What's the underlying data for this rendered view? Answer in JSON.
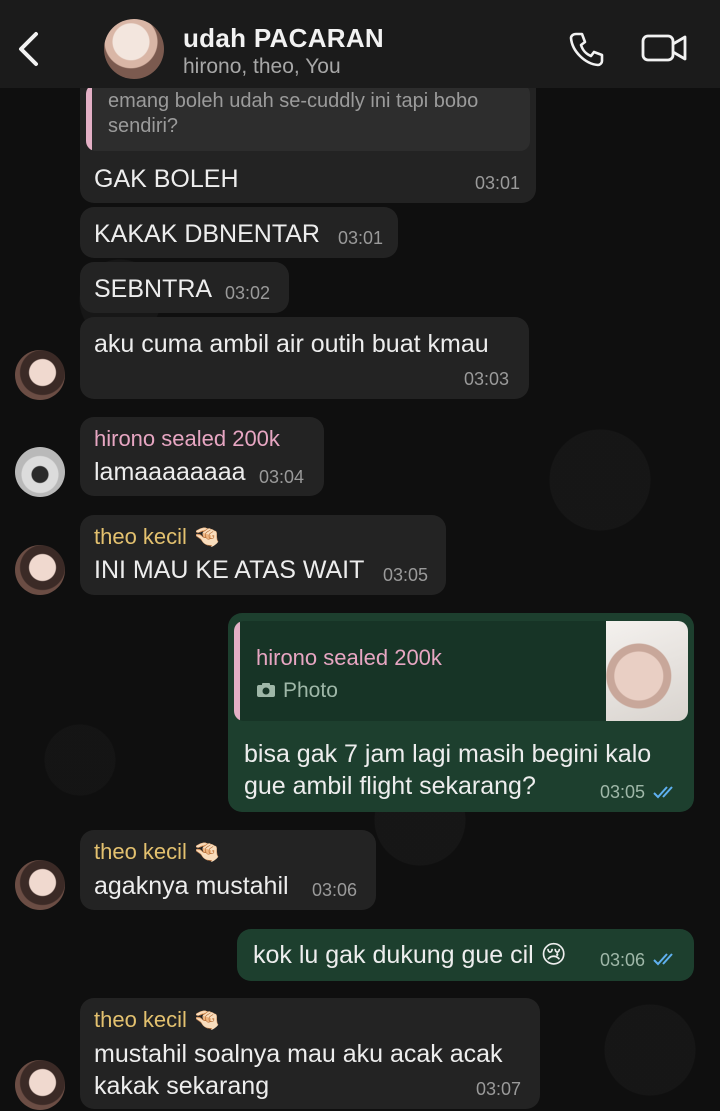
{
  "header": {
    "title": "udah PACARAN",
    "subtitle": "hirono, theo, You"
  },
  "colors": {
    "header_bg": "#1b1b1b",
    "incoming_bubble": "#232323",
    "outgoing_bubble": "#1d3f2e",
    "sender_hirono": "#e7a6c2",
    "sender_theo": "#e3c16f",
    "read_ticks": "#5fb0f0"
  },
  "messages": {
    "m0": {
      "quote": "emang boleh udah se-cuddly ini tapi bobo sendiri?",
      "text": "GAK BOLEH",
      "time": "03:01"
    },
    "m1": {
      "text": "KAKAK DBNENTAR",
      "time": "03:01"
    },
    "m2": {
      "text": "SEBNTRA",
      "time": "03:02"
    },
    "m3": {
      "text": "aku cuma ambil air outih buat kmau",
      "time": "03:03"
    },
    "m4": {
      "sender": "hirono sealed 200k",
      "text": "lamaaaaaaaa",
      "time": "03:04"
    },
    "m5": {
      "sender": "theo kecil 🤏🏻",
      "text": "INI MAU KE ATAS WAIT",
      "time": "03:05"
    },
    "m6": {
      "quote_sender": "hirono sealed 200k",
      "quote_text": "Photo",
      "line1": "bisa gak 7 jam lagi masih begini kalo",
      "line2": "gue ambil flight sekarang?",
      "time": "03:05"
    },
    "m7": {
      "sender": "theo kecil 🤏🏻",
      "text": "agaknya mustahil",
      "time": "03:06"
    },
    "m8": {
      "text": "kok lu gak dukung gue cil 😢",
      "time": "03:06"
    },
    "m9": {
      "sender": "theo kecil 🤏🏻",
      "line1": "mustahil soalnya mau aku acak acak",
      "line2": "kakak sekarang",
      "time": "03:07"
    }
  }
}
